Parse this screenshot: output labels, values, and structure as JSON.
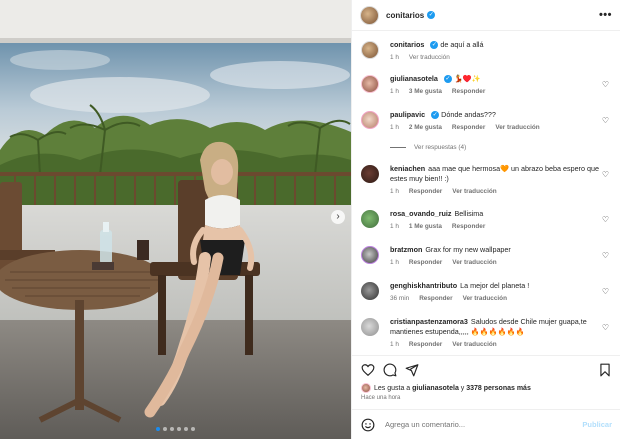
{
  "post": {
    "owner": "conitarios",
    "more_label": "•••",
    "dots_total": 6,
    "dot_active_index": 0,
    "next_arrow": "›"
  },
  "caption": {
    "username": "conitarios",
    "text": "de aquí a allá",
    "time": "1 h",
    "translate": "Ver traducción"
  },
  "comments": [
    {
      "username": "giulianasotela",
      "verified": true,
      "text": "💃♥️✨",
      "time": "1 h",
      "likes": "3 Me gusta",
      "reply": "Responder",
      "translate": ""
    },
    {
      "username": "paulipavic",
      "verified": true,
      "text": "Dónde andas???",
      "time": "1 h",
      "likes": "2 Me gusta",
      "reply": "Responder",
      "translate": "Ver traducción"
    },
    {
      "username": "keniachen",
      "verified": false,
      "text": "aaa mae que hermosa🧡 un abrazo beba espero que estes muy bien!! :)",
      "time": "1 h",
      "likes": "",
      "reply": "Responder",
      "translate": "Ver traducción"
    },
    {
      "username": "rosa_ovando_ruiz",
      "verified": false,
      "text": "Bellisima",
      "time": "1 h",
      "likes": "1 Me gusta",
      "reply": "Responder",
      "translate": ""
    },
    {
      "username": "bratzmon",
      "verified": false,
      "text": "Grax for my new wallpaper",
      "time": "1 h",
      "likes": "",
      "reply": "Responder",
      "translate": "Ver traducción"
    },
    {
      "username": "genghiskhantributo",
      "verified": false,
      "text": "La mejor del planeta !",
      "time": "36 min",
      "likes": "",
      "reply": "Responder",
      "translate": "Ver traducción"
    },
    {
      "username": "cristianpastenzamora3",
      "verified": false,
      "text": "Saludos desde Chile mujer guapa,te mantienes estupenda,,,,, 🔥🔥🔥🔥🔥🔥",
      "time": "1 h",
      "likes": "",
      "reply": "Responder",
      "translate": "Ver traducción"
    }
  ],
  "view_replies": "Ver respuestas (4)",
  "icons": [
    "heart-icon",
    "comment-icon",
    "share-icon",
    "bookmark-icon"
  ],
  "likes_summary": {
    "prefix": "Les gusta a",
    "user": "giulianasotela",
    "connector": "y",
    "others": "3378 personas más"
  },
  "timestamp": "Hace una hora",
  "composer": {
    "placeholder": "Agrega un comentario...",
    "publish": "Publicar",
    "emoji_icon": "emoji-icon"
  },
  "colors": {
    "verified": "#1d9bf0",
    "publish_disabled": "#b2dffc",
    "active_dot": "#1a8cf0"
  }
}
